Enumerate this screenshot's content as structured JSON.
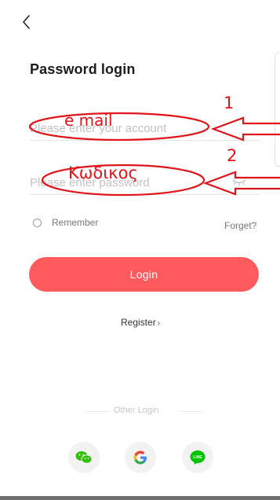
{
  "header": {
    "title": "Password login",
    "back_icon": "chevron-left-icon"
  },
  "form": {
    "account_placeholder": "Please enter your account",
    "account_value": "",
    "password_placeholder": "Please enter password",
    "password_value": "",
    "eye_icon": "eye-closed-icon",
    "remember_label": "Remember",
    "forget_label": "Forget?",
    "login_label": "Login",
    "register_label": "Register",
    "register_chevron": "›"
  },
  "other_login": {
    "label": "Other Login",
    "providers": [
      {
        "name": "wechat",
        "icon": "wechat-icon",
        "color": "#2dc100"
      },
      {
        "name": "google",
        "icon": "google-icon",
        "color": "#4285f4"
      },
      {
        "name": "line",
        "icon": "line-icon",
        "color": "#00c300"
      }
    ]
  },
  "annotations": {
    "email_text": "e mail",
    "password_text": "Κωδικος",
    "number_1": "1",
    "number_2": "2",
    "color": "#e0151b"
  },
  "colors": {
    "accent": "#ff5a5d",
    "background": "#ffffff",
    "muted_text": "#777777",
    "placeholder": "#c2c2c2"
  }
}
